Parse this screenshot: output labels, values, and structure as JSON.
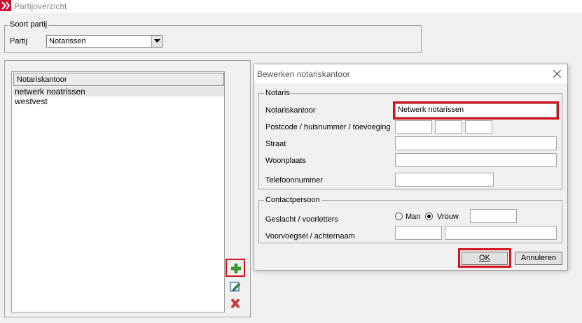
{
  "window": {
    "title": "Partijoverzicht"
  },
  "soort": {
    "group_label": "Soort partij",
    "partij_label": "Partij",
    "partij_value": "Notarissen"
  },
  "list": {
    "header": "Notariskantoor",
    "items": [
      "netwerk noatrissen",
      "westvest"
    ]
  },
  "toolbar": {
    "add_icon": "plus-icon",
    "edit_icon": "edit-icon",
    "delete_icon": "delete-icon"
  },
  "dialog": {
    "title": "Bewerken notariskantoor",
    "notaris_group": "Notaris",
    "notariskantoor_label": "Notariskantoor",
    "notariskantoor_value": "Netwerk notarissen",
    "postcode_label": "Postcode / huisnummer / toevoeging",
    "straat_label": "Straat",
    "woonplaats_label": "Woonplaats",
    "telefoon_label": "Telefoonnummer",
    "contact_group": "Contactpersoon",
    "geslacht_label": "Geslacht / voorletters",
    "radio_man": "Man",
    "radio_vrouw": "Vrouw",
    "selected_gender": "Vrouw",
    "voorvoegsel_label": "Voorvoegsel / achternaam",
    "ok_label": "OK",
    "cancel_label": "Annuleren"
  },
  "colors": {
    "highlight": "#d3121c",
    "window_bg": "#f0f0f0"
  }
}
